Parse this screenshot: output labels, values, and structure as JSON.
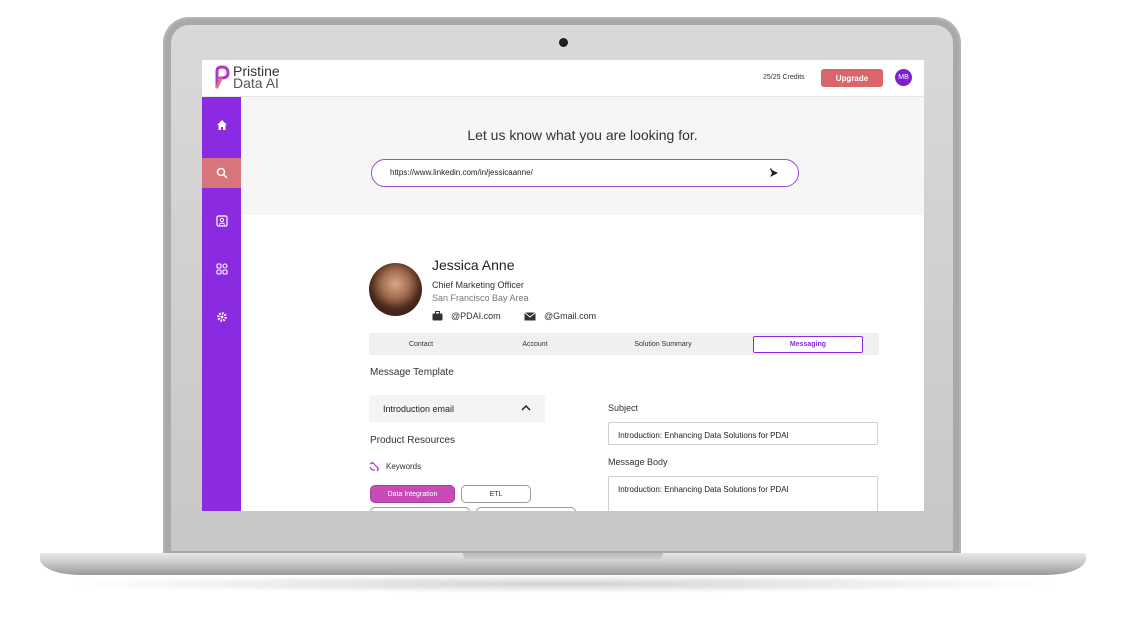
{
  "header": {
    "logo_line1": "Pristine",
    "logo_line2": "Data AI",
    "credits": "25/25 Credits",
    "upgrade_label": "Upgrade",
    "user_initials": "MB"
  },
  "sidebar": {
    "items": [
      {
        "icon": "home-icon"
      },
      {
        "icon": "search-icon",
        "active": true
      },
      {
        "icon": "contact-icon"
      },
      {
        "icon": "apps-icon"
      },
      {
        "icon": "gear-icon"
      }
    ]
  },
  "search": {
    "title": "Let us know what you are looking for.",
    "value": "https://www.linkedin.com/in/jessicaanne/"
  },
  "profile": {
    "name": "Jessica Anne",
    "role": "Chief Marketing Officer",
    "location": "San Francisco Bay Area",
    "work_email": "@PDAI.com",
    "personal_email": "@Gmail.com"
  },
  "tabs": [
    "Contact",
    "Account",
    "Solution Summary",
    "Messaging"
  ],
  "messaging": {
    "template_label": "Message Template",
    "template_value": "Introduction email",
    "resources_label": "Product Resources",
    "keywords_label": "Keywords",
    "chips": [
      "Data Integration",
      "ETL"
    ],
    "subject_label": "Subject",
    "subject_value": "Introduction: Enhancing Data Solutions for PDAI",
    "body_label": "Message Body",
    "body_value": "Introduction: Enhancing Data Solutions for PDAI"
  },
  "colors": {
    "accent": "#8a2be2",
    "upgrade": "#d9666a",
    "sidebar_active": "#d7747c"
  }
}
